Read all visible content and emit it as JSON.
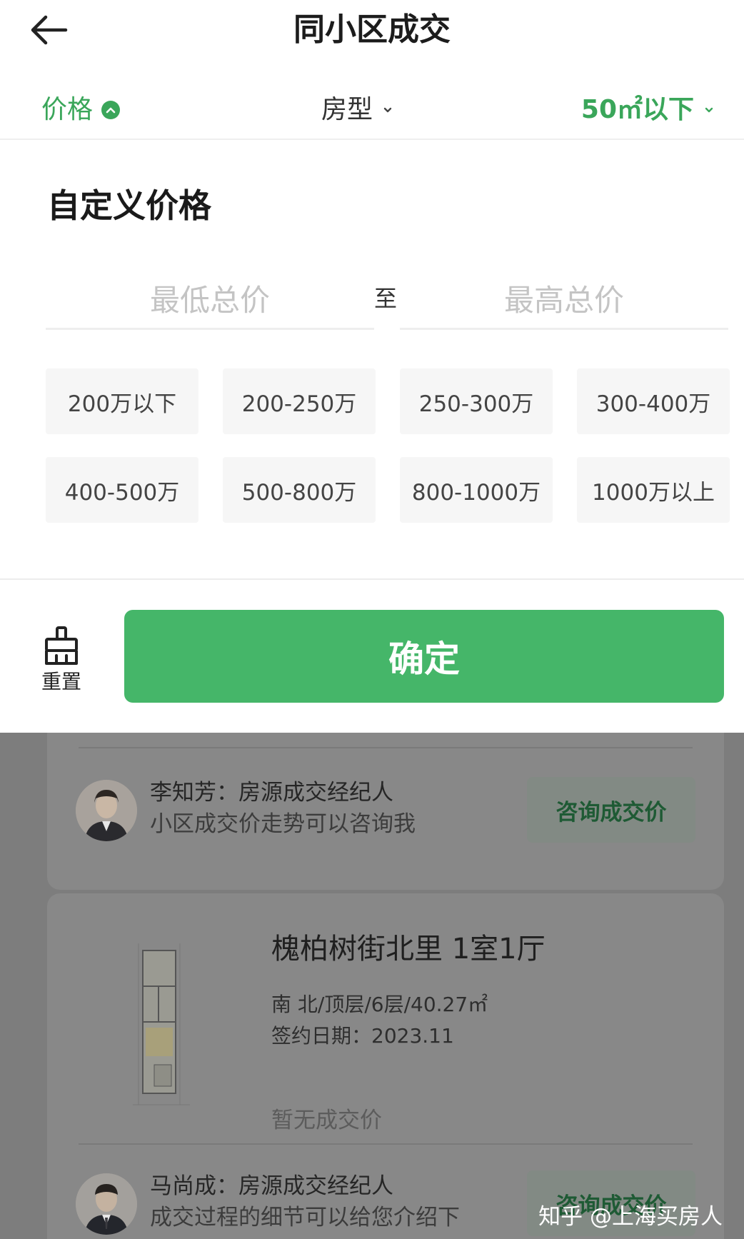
{
  "header": {
    "title": "同小区成交",
    "back_icon": "arrow-left-icon"
  },
  "filters": {
    "price_label": "价格",
    "type_label": "房型",
    "area_label": "50㎡以下",
    "active_color": "#3aa65a"
  },
  "custom_price": {
    "title": "自定义价格",
    "min_placeholder": "最低总价",
    "separator": "至",
    "max_placeholder": "最高总价",
    "options": [
      "200万以下",
      "200-250万",
      "250-300万",
      "300-400万",
      "400-500万",
      "500-800万",
      "800-1000万",
      "1000万以上"
    ]
  },
  "actions": {
    "reset_label": "重置",
    "confirm_label": "确定",
    "confirm_color": "#45b669"
  },
  "list": {
    "agent_1": {
      "name": "李知芳：房源成交经纪人",
      "desc": "小区成交价走势可以咨询我",
      "button": "咨询成交价"
    },
    "listing": {
      "title": "槐柏树街北里 1室1厅",
      "meta": "南 北/顶层/6层/40.27㎡",
      "date": "签约日期：2023.11",
      "price": "暂无成交价"
    },
    "agent_2": {
      "name": "马尚成：房源成交经纪人",
      "desc": "成交过程的细节可以给您介绍下",
      "button": "咨询成交价"
    }
  },
  "watermark": "知乎 @上海买房人"
}
